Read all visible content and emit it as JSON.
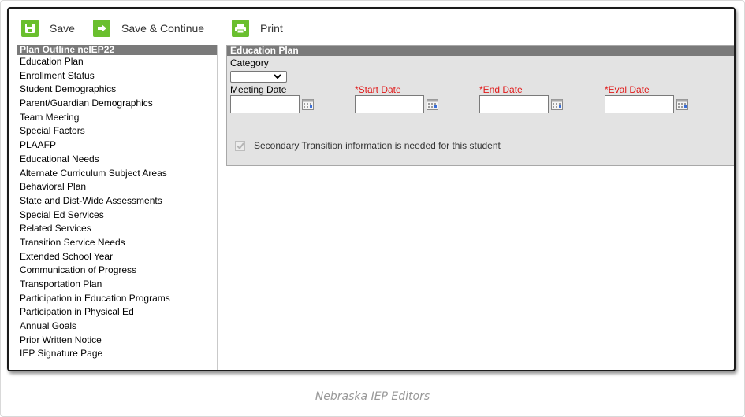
{
  "toolbar": {
    "save_label": "Save",
    "save_continue_label": "Save & Continue",
    "print_label": "Print"
  },
  "sidebar": {
    "header": "Plan Outline neIEP22",
    "items": [
      "Education Plan",
      "Enrollment Status",
      "Student Demographics",
      "Parent/Guardian Demographics",
      "Team Meeting",
      "Special Factors",
      "PLAAFP",
      "Educational Needs",
      "Alternate Curriculum Subject Areas",
      "Behavioral Plan",
      "State and Dist-Wide Assessments",
      "Special Ed Services",
      "Related Services",
      "Transition Service Needs",
      "Extended School Year",
      "Communication of Progress",
      "Transportation Plan",
      "Participation in Education Programs",
      "Participation in Physical Ed",
      "Annual Goals",
      "Prior Written Notice",
      "IEP Signature Page"
    ]
  },
  "main": {
    "header": "Education Plan",
    "category_label": "Category",
    "category_value": "",
    "meeting_date_label": "Meeting Date",
    "start_date_label": "*Start Date",
    "end_date_label": "*End Date",
    "eval_date_label": "*Eval Date",
    "meeting_date_value": "",
    "start_date_value": "",
    "end_date_value": "",
    "eval_date_value": "",
    "transition_checkbox_label": "Secondary Transition information is needed for this student",
    "transition_checked": true
  },
  "caption": "Nebraska IEP Editors",
  "colors": {
    "toolbar_icon": "#6abf2e",
    "panel_header": "#7a7a7a",
    "panel_bg": "#e3e3e3",
    "required_label": "#e01a1a"
  }
}
